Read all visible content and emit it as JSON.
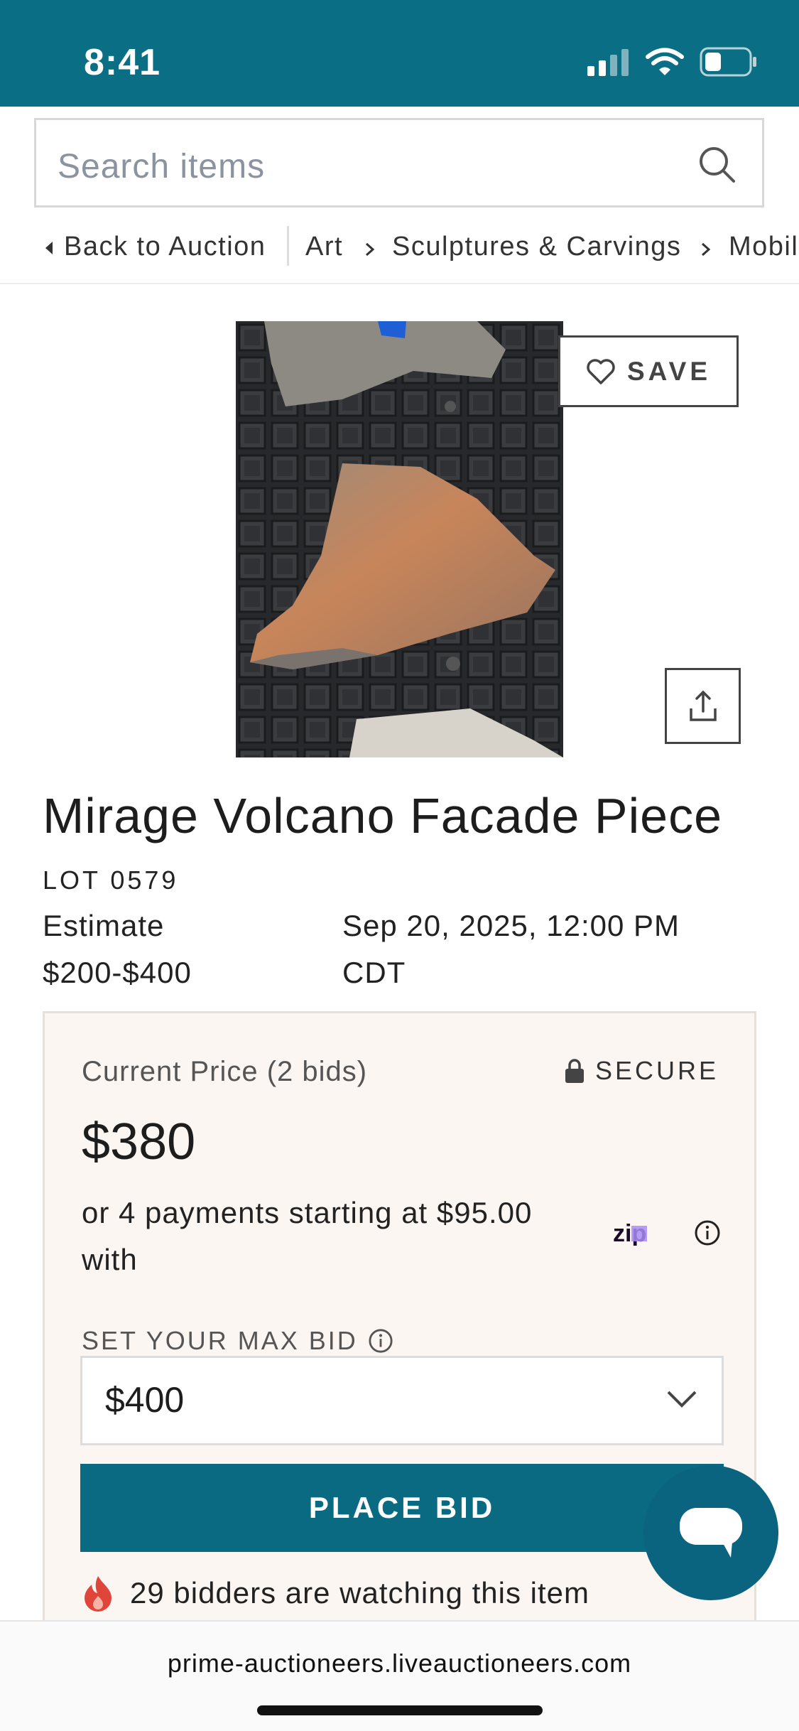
{
  "status_bar": {
    "time": "8:41",
    "accent": "#0a6e84"
  },
  "search": {
    "placeholder": "Search items",
    "icon": "search-icon"
  },
  "breadcrumb": {
    "back": "Back to Auction",
    "items": [
      "Art",
      "Sculptures & Carvings",
      "Mobil"
    ]
  },
  "item": {
    "save_label": "SAVE",
    "title": "Mirage Volcano Facade Piece",
    "lot": "LOT 0579",
    "estimate": "Estimate $200-$400",
    "datetime": "Sep 20, 2025, 12:00 PM CDT"
  },
  "bidding": {
    "current_price_label": "Current Price (2 bids)",
    "secure_label": "SECURE",
    "price": "$380",
    "payments_text": "or 4 payments starting at $95.00 with",
    "zip_logo": "zip",
    "max_bid_label": "SET YOUR MAX BID",
    "max_bid_value": "$400",
    "place_bid_label": "PLACE BID",
    "watchers_text": "29 bidders are watching this item"
  },
  "browser": {
    "url": "prime-auctioneers.liveauctioneers.com"
  }
}
